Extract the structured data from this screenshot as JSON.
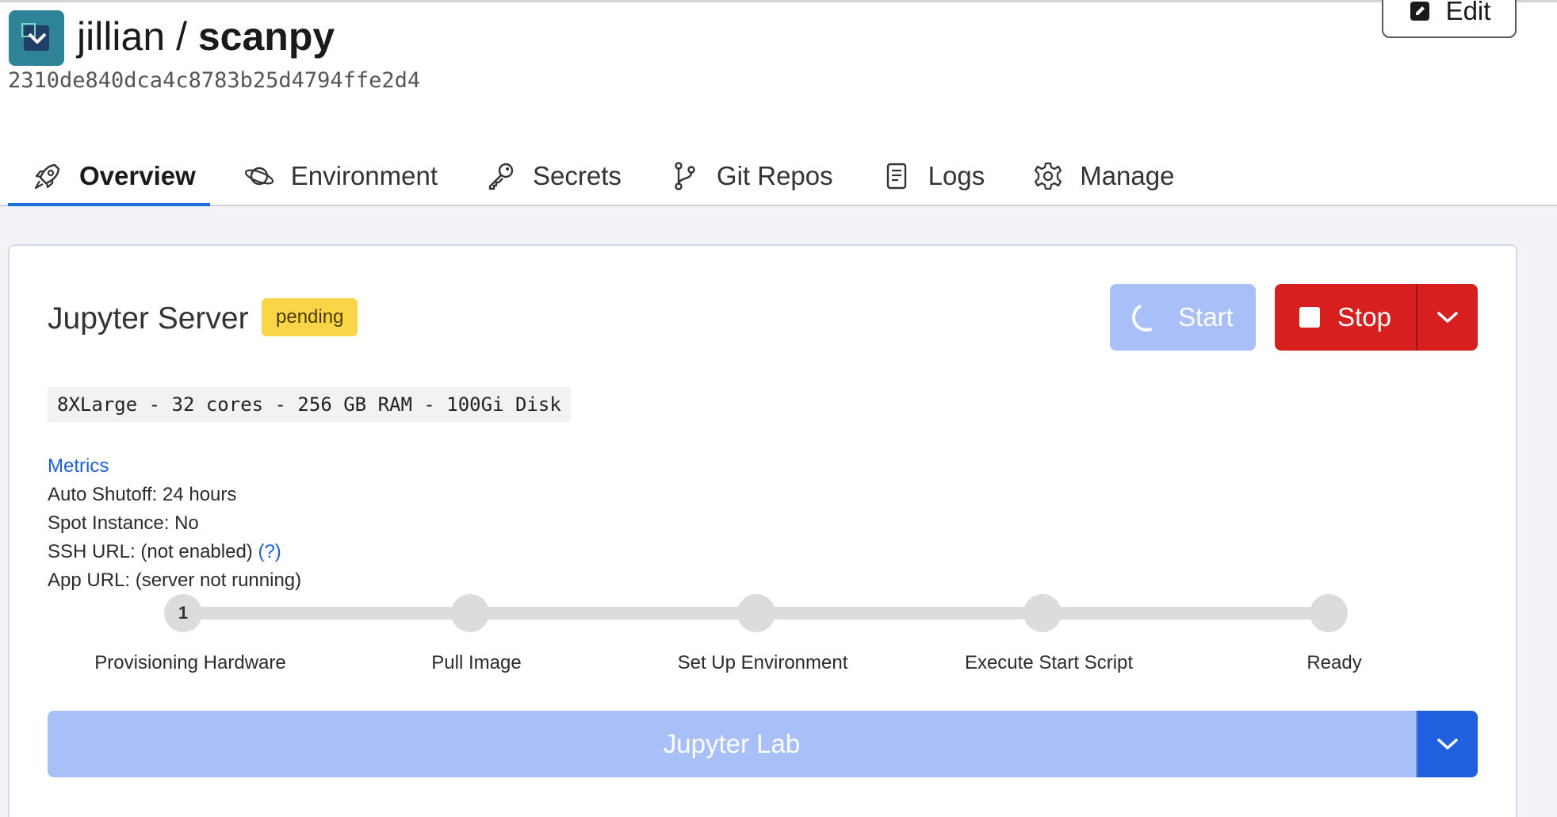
{
  "header": {
    "owner": "jillian",
    "separator": " / ",
    "repo": "scanpy",
    "commit": "2310de840dca4c8783b25d4794ffe2d4",
    "edit_label": "Edit"
  },
  "tabs": [
    {
      "label": "Overview",
      "icon": "rocket-icon",
      "active": true
    },
    {
      "label": "Environment",
      "icon": "planet-icon",
      "active": false
    },
    {
      "label": "Secrets",
      "icon": "key-icon",
      "active": false
    },
    {
      "label": "Git Repos",
      "icon": "git-branch-icon",
      "active": false
    },
    {
      "label": "Logs",
      "icon": "document-icon",
      "active": false
    },
    {
      "label": "Manage",
      "icon": "gear-icon",
      "active": false
    }
  ],
  "server": {
    "title": "Jupyter Server",
    "status": "pending",
    "start_label": "Start",
    "stop_label": "Stop",
    "spec": "8XLarge - 32 cores - 256 GB RAM - 100Gi Disk",
    "metrics_link": "Metrics",
    "auto_shutoff": "Auto Shutoff: 24 hours",
    "spot_instance": "Spot Instance: No",
    "ssh_url": "SSH URL: (not enabled)",
    "ssh_help": "(?)",
    "app_url": "App URL: (server not running)"
  },
  "stepper": {
    "current_step": 1,
    "steps": [
      {
        "label": "Provisioning Hardware",
        "number": "1"
      },
      {
        "label": "Pull Image",
        "number": ""
      },
      {
        "label": "Set Up Environment",
        "number": ""
      },
      {
        "label": "Execute Start Script",
        "number": ""
      },
      {
        "label": "Ready",
        "number": ""
      }
    ]
  },
  "launch": {
    "label": "Jupyter Lab"
  },
  "colors": {
    "accent": "#1d6fdb",
    "stop": "#d71f1f",
    "badge": "#f9d547",
    "disabled_primary": "#a8bff7"
  }
}
